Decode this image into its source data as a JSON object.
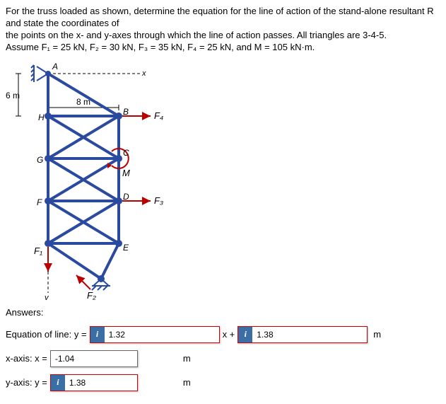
{
  "problem": {
    "line1": "For the truss loaded as shown, determine the equation for the line of action of the stand-alone resultant R and state the coordinates of",
    "line2": "the points on the x- and y-axes through which the line of action passes. All triangles are 3-4-5.",
    "line3": "Assume F₁ = 25 kN, F₂ = 30 kN, F₃ = 35 kN, F₄ = 25 kN, and M = 105 kN·m."
  },
  "diagram": {
    "points": {
      "A": "A",
      "B": "B",
      "C": "C",
      "D": "D",
      "E": "E",
      "F": "F",
      "G": "G",
      "H": "H"
    },
    "forces": {
      "F1": "F₁",
      "F2": "F₂",
      "F3": "F₃",
      "F4": "F₄"
    },
    "dims": {
      "six_m": "6 m",
      "eight_m": "8 m"
    },
    "axes": {
      "x": "x",
      "y": "y"
    },
    "M": "M"
  },
  "answers": {
    "heading": "Answers:",
    "eq_label": "Equation of line: y =",
    "eq_val1": "1.32",
    "xplus": "x +",
    "eq_val2": "1.38",
    "unit_m": "m",
    "xaxis_label": "x-axis: x =",
    "xaxis_val": "-1.04",
    "yaxis_label": "y-axis: y =",
    "yaxis_val": "1.38"
  },
  "badge": "i"
}
